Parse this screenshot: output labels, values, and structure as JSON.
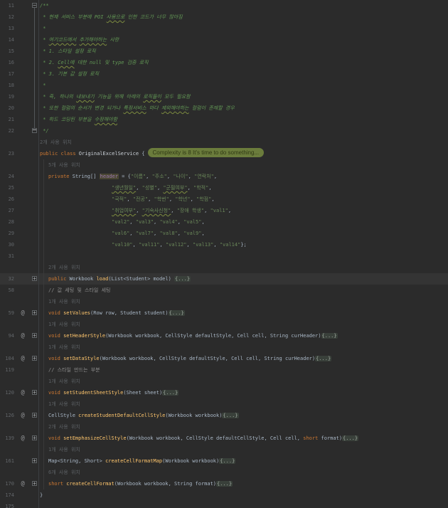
{
  "editor": {
    "badge": {
      "label": "Complexity is 8 It's time to do something..."
    },
    "colors": {
      "background": "#2b2b2b",
      "caret_row": "#343434",
      "line_number": "#62666a",
      "keyword": "#cc7832",
      "string": "#6a8759",
      "doc_comment": "#629755",
      "line_comment": "#8a8a8a",
      "method_name": "#ffc66d",
      "field_highlight_bg": "#4a4733",
      "field_name": "#9876aa",
      "badge_bg": "#6b7c3c",
      "typo_wave": "#7d8c3f"
    },
    "rows": [
      {
        "num": "11",
        "fold": "minus",
        "ind": "cls",
        "tk": [
          [
            "cm",
            "/**"
          ]
        ]
      },
      {
        "num": "12",
        "fline": 1,
        "ind": "cls",
        "tk": [
          [
            "cm",
            " * 현재 서비스 부분에 POI "
          ],
          [
            "cmw",
            "사용으로"
          ],
          [
            "cm",
            " 인한 코드가 너무 많아짐"
          ]
        ]
      },
      {
        "num": "13",
        "fline": 1,
        "ind": "cls",
        "tk": [
          [
            "cm",
            " *"
          ]
        ]
      },
      {
        "num": "14",
        "fline": 1,
        "ind": "cls",
        "tk": [
          [
            "cm",
            " * "
          ],
          [
            "cmw",
            "여기코드에서"
          ],
          [
            "cm",
            " "
          ],
          [
            "cmw",
            "추가해야하는"
          ],
          [
            "cm",
            " 사항"
          ]
        ]
      },
      {
        "num": "15",
        "fline": 1,
        "ind": "cls",
        "tk": [
          [
            "cm",
            " * 1. 스타일 설정 로직"
          ]
        ]
      },
      {
        "num": "16",
        "fline": 1,
        "ind": "cls",
        "tk": [
          [
            "cm",
            " * 2. "
          ],
          [
            "cmw",
            "Cell에"
          ],
          [
            "cm",
            " 대한 null 및 type 검증 로직"
          ]
        ]
      },
      {
        "num": "17",
        "fline": 1,
        "ind": "cls",
        "tk": [
          [
            "cm",
            " * 3. 기본 값 설정 로직"
          ]
        ]
      },
      {
        "num": "18",
        "fline": 1,
        "ind": "cls",
        "tk": [
          [
            "cm",
            " *"
          ]
        ]
      },
      {
        "num": "19",
        "fline": 1,
        "ind": "cls",
        "tk": [
          [
            "cm",
            " * 즉, 하나의 "
          ],
          [
            "cmw",
            "내보내기"
          ],
          [
            "cm",
            " 기능을 위해 아래의 "
          ],
          [
            "cmw",
            "로직들이"
          ],
          [
            "cm",
            " 모두 필요함"
          ]
        ]
      },
      {
        "num": "20",
        "fline": 1,
        "ind": "cls",
        "tk": [
          [
            "cm",
            " * 또한 컬럼의 순서가 변경 되거나 "
          ],
          [
            "cmw",
            "특정서비스"
          ],
          [
            "cm",
            " 마다 "
          ],
          [
            "cmw",
            "제외해야하는"
          ],
          [
            "cm",
            " 컬럼이 존재할 경우"
          ]
        ]
      },
      {
        "num": "21",
        "fline": 1,
        "ind": "cls",
        "tk": [
          [
            "cm",
            " * 하드 코딩된 부분을 "
          ],
          [
            "cmw",
            "수정해야함"
          ]
        ]
      },
      {
        "num": "22",
        "fold": "end",
        "ind": "cls",
        "tk": [
          [
            "cm",
            " */"
          ]
        ]
      },
      {
        "hint": "2개 사용 위치",
        "ind": "cls"
      },
      {
        "num": "23",
        "ind": "cls",
        "badge": 1,
        "tk": [
          [
            "kw",
            "public class"
          ],
          [
            "cn",
            " OriginalExcelService"
          ],
          [
            "pl",
            " {"
          ]
        ]
      },
      {
        "hint": "5개 사용 위치",
        "ind": "mem"
      },
      {
        "num": "24",
        "ind": "mem",
        "tk": [
          [
            "kw",
            "private"
          ],
          [
            "pl",
            " String[] "
          ],
          [
            "fh",
            "header"
          ],
          [
            "pl",
            " = {"
          ],
          [
            "st",
            "\"이름\""
          ],
          [
            "pl",
            ", "
          ],
          [
            "st",
            "\"주소\""
          ],
          [
            "pl",
            ", "
          ],
          [
            "st",
            "\"나이\""
          ],
          [
            "pl",
            ", "
          ],
          [
            "st",
            "\"연락처\""
          ],
          [
            "pl",
            ","
          ]
        ]
      },
      {
        "num": "25",
        "ind": "cont",
        "tk": [
          [
            "stw",
            "\"생년월일\""
          ],
          [
            "pl",
            ", "
          ],
          [
            "st",
            "\"성별\""
          ],
          [
            "pl",
            ", "
          ],
          [
            "stw",
            "\"군필여부\""
          ],
          [
            "pl",
            ", "
          ],
          [
            "st",
            "\"학적\""
          ],
          [
            "pl",
            ","
          ]
        ]
      },
      {
        "num": "26",
        "ind": "cont",
        "tk": [
          [
            "st",
            "\"국적\""
          ],
          [
            "pl",
            ", "
          ],
          [
            "st",
            "\"전공\""
          ],
          [
            "pl",
            ", "
          ],
          [
            "st",
            "\"학번\""
          ],
          [
            "pl",
            ", "
          ],
          [
            "st",
            "\"학년\""
          ],
          [
            "pl",
            ", "
          ],
          [
            "st",
            "\"학점\""
          ],
          [
            "pl",
            ","
          ]
        ]
      },
      {
        "num": "27",
        "ind": "cont",
        "tk": [
          [
            "stw",
            "\"취업여부\""
          ],
          [
            "pl",
            ", "
          ],
          [
            "stw",
            "\"기숙사신청\""
          ],
          [
            "pl",
            ", "
          ],
          [
            "st",
            "\"장애 학생\""
          ],
          [
            "pl",
            ", "
          ],
          [
            "st",
            "\"val1\""
          ],
          [
            "pl",
            ","
          ]
        ]
      },
      {
        "num": "28",
        "ind": "cont",
        "tk": [
          [
            "st",
            "\"val2\""
          ],
          [
            "pl",
            ", "
          ],
          [
            "st",
            "\"val3\""
          ],
          [
            "pl",
            ", "
          ],
          [
            "st",
            "\"val4\""
          ],
          [
            "pl",
            ", "
          ],
          [
            "st",
            "\"val5\""
          ],
          [
            "pl",
            ","
          ]
        ]
      },
      {
        "num": "29",
        "ind": "cont",
        "tk": [
          [
            "st",
            "\"val6\""
          ],
          [
            "pl",
            ", "
          ],
          [
            "st",
            "\"val7\""
          ],
          [
            "pl",
            ", "
          ],
          [
            "st",
            "\"val8\""
          ],
          [
            "pl",
            ", "
          ],
          [
            "st",
            "\"val9\""
          ],
          [
            "pl",
            ","
          ]
        ]
      },
      {
        "num": "30",
        "ind": "cont",
        "tk": [
          [
            "st",
            "\"val10\""
          ],
          [
            "pl",
            ", "
          ],
          [
            "st",
            "\"val11\""
          ],
          [
            "pl",
            ", "
          ],
          [
            "st",
            "\"val12\""
          ],
          [
            "pl",
            ", "
          ],
          [
            "st",
            "\"val13\""
          ],
          [
            "pl",
            ", "
          ],
          [
            "st",
            "\"val14\""
          ],
          [
            "pl",
            "};"
          ]
        ]
      },
      {
        "num": "31",
        "ind": "mem",
        "tk": []
      },
      {
        "hint": "2개 사용 위치",
        "ind": "mem"
      },
      {
        "num": "32",
        "fold": "plus",
        "hl": 1,
        "ind": "mem",
        "tk": [
          [
            "kw",
            "public"
          ],
          [
            "pl",
            " Workbook "
          ],
          [
            "mt",
            "load"
          ],
          [
            "pl",
            "(List<Student> model) "
          ],
          [
            "fd",
            "{...}"
          ]
        ]
      },
      {
        "num": "58",
        "ind": "mem",
        "tk": [
          [
            "lc",
            "// 값 세팅 및 스타일 세팅"
          ]
        ]
      },
      {
        "hint": "1개 사용 위치",
        "ind": "mem"
      },
      {
        "num": "59",
        "icon": 1,
        "fold": "plus",
        "ind": "mem",
        "tk": [
          [
            "kw",
            "void"
          ],
          [
            "pl",
            " "
          ],
          [
            "mt",
            "setValues"
          ],
          [
            "pl",
            "(Row row, Student student)"
          ],
          [
            "fd",
            "{...}"
          ]
        ]
      },
      {
        "hint": "1개 사용 위치",
        "ind": "mem"
      },
      {
        "num": "94",
        "icon": 1,
        "fold": "plus",
        "ind": "mem",
        "tk": [
          [
            "kw",
            "void"
          ],
          [
            "pl",
            " "
          ],
          [
            "mt",
            "setHeaderStyle"
          ],
          [
            "pl",
            "(Workbook workbook, CellStyle defaultStyle, Cell cell, String curHeader)"
          ],
          [
            "fd",
            "{...}"
          ]
        ]
      },
      {
        "hint": "1개 사용 위치",
        "ind": "mem"
      },
      {
        "num": "104",
        "icon": 1,
        "fold": "plus",
        "ind": "mem",
        "tk": [
          [
            "kw",
            "void"
          ],
          [
            "pl",
            " "
          ],
          [
            "mt",
            "setDataStyle"
          ],
          [
            "pl",
            "(Workbook workbook, CellStyle defaultStyle, Cell cell, String curHeader)"
          ],
          [
            "fd",
            "{...}"
          ]
        ]
      },
      {
        "num": "119",
        "ind": "mem",
        "tk": [
          [
            "lc",
            "// 스타일 만드는 부분"
          ]
        ]
      },
      {
        "hint": "1개 사용 위치",
        "ind": "mem"
      },
      {
        "num": "120",
        "icon": 1,
        "fold": "plus",
        "ind": "mem",
        "tk": [
          [
            "kw",
            "void"
          ],
          [
            "pl",
            " "
          ],
          [
            "mt",
            "setStudentSheetStyle"
          ],
          [
            "pl",
            "(Sheet sheet)"
          ],
          [
            "fd",
            "{...}"
          ]
        ]
      },
      {
        "hint": "1개 사용 위치",
        "ind": "mem"
      },
      {
        "num": "126",
        "icon": 1,
        "fold": "plus",
        "ind": "mem",
        "tk": [
          [
            "pl",
            "CellStyle "
          ],
          [
            "mt",
            "createStudentDefaultCellStyle"
          ],
          [
            "pl",
            "(Workbook workbook)"
          ],
          [
            "fd",
            "{...}"
          ]
        ]
      },
      {
        "hint": "2개 사용 위치",
        "ind": "mem"
      },
      {
        "num": "139",
        "icon": 1,
        "fold": "plus",
        "ind": "mem",
        "tk": [
          [
            "kw",
            "void"
          ],
          [
            "pl",
            " "
          ],
          [
            "mt",
            "setEmphasizeCellStyle"
          ],
          [
            "pl",
            "(Workbook workbook, CellStyle defaultCellStyle, Cell cell, "
          ],
          [
            "kw",
            "short"
          ],
          [
            "pl",
            " format)"
          ],
          [
            "fd",
            "{...}"
          ]
        ]
      },
      {
        "hint": "1개 사용 위치",
        "ind": "mem"
      },
      {
        "num": "161",
        "fold": "plus",
        "ind": "mem",
        "tk": [
          [
            "pl",
            "Map<String, Short> "
          ],
          [
            "mt",
            "createCellFormatMap"
          ],
          [
            "pl",
            "(Workbook workbook)"
          ],
          [
            "fd",
            "{...}"
          ]
        ]
      },
      {
        "hint": "6개 사용 위치",
        "ind": "mem"
      },
      {
        "num": "170",
        "icon": 1,
        "fold": "plus",
        "ind": "mem",
        "tk": [
          [
            "kw",
            "short"
          ],
          [
            "pl",
            " "
          ],
          [
            "mt",
            "createCellFormat"
          ],
          [
            "pl",
            "(Workbook workbook, String format)"
          ],
          [
            "fd",
            "{...}"
          ]
        ]
      },
      {
        "num": "174",
        "ind": "cls",
        "tk": [
          [
            "pl",
            "}"
          ]
        ]
      },
      {
        "num": "175",
        "ind": "cls",
        "tk": []
      }
    ]
  }
}
